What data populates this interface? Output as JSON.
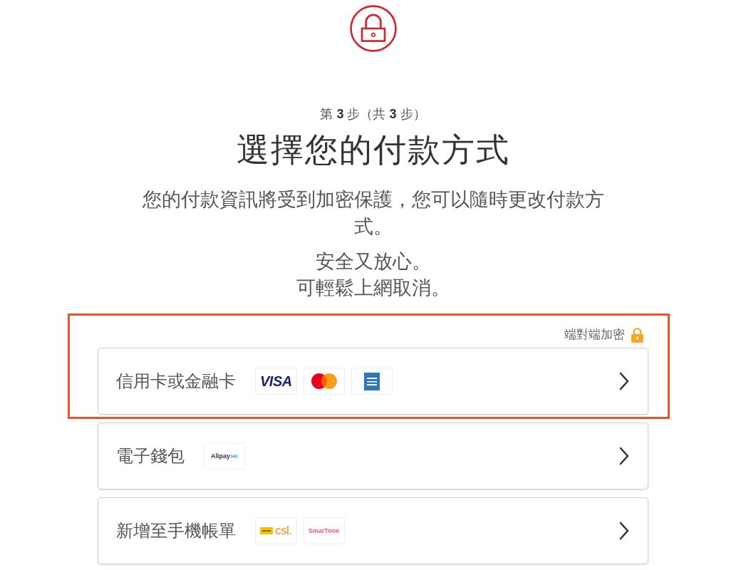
{
  "header": {
    "step": "第 **3** 步（共 **3** 步）",
    "title": "選擇您的付款方式",
    "description": "您的付款資訊將受到加密保護，您可以隨時更改付款方式。",
    "assurances": [
      "安全又放心。",
      "可輕鬆上網取消。"
    ]
  },
  "payment": {
    "secure_note": "端對端加密",
    "options": [
      {
        "label": "信用卡或金融卡",
        "highlighted": true,
        "logos": [
          {
            "kind": "wordmark",
            "text": "VISA",
            "color": "#1a1f71"
          },
          {
            "kind": "circles"
          },
          {
            "kind": "square"
          }
        ]
      },
      {
        "label": "電子錢包",
        "highlighted": false,
        "logos": [
          {
            "kind": "small",
            "text": "Alipay",
            "suffix": "HK",
            "color": "#333333"
          }
        ]
      },
      {
        "label": "新增至手機帳單",
        "highlighted": false,
        "logos": [
          {
            "kind": "badge",
            "text": "csl.",
            "color": "#f08a1c"
          },
          {
            "kind": "small",
            "text": "SmarTone",
            "color": "#e8587a"
          }
        ]
      }
    ]
  }
}
